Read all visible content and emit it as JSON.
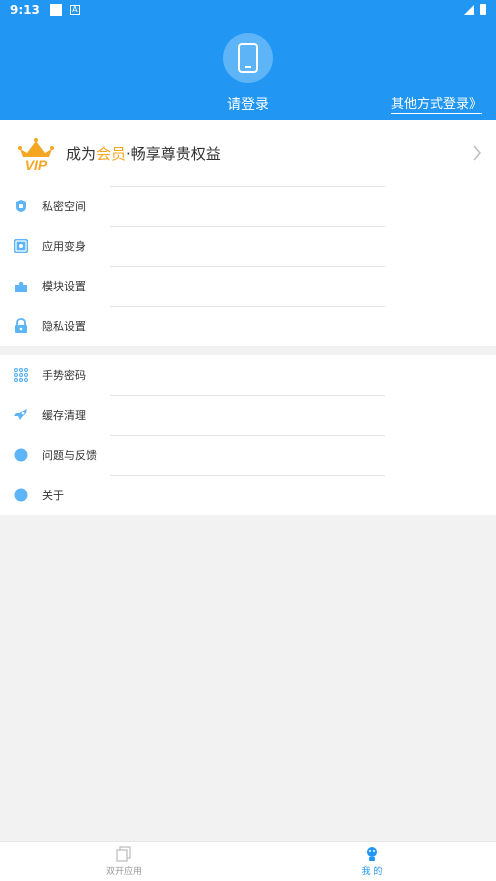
{
  "status_bar": {
    "time": "9:13",
    "notif_a": "A"
  },
  "header": {
    "login_label": "请登录",
    "other_login_label": "其他方式登录》"
  },
  "vip": {
    "text_prefix": "成为",
    "text_highlight": "会员",
    "text_suffix": "·畅享尊贵权益",
    "badge_text": "VIP"
  },
  "menu_group_1": [
    {
      "label": "私密空间",
      "icon": "private-space-icon"
    },
    {
      "label": "应用变身",
      "icon": "app-disguise-icon"
    },
    {
      "label": "模块设置",
      "icon": "module-settings-icon"
    },
    {
      "label": "隐私设置",
      "icon": "privacy-lock-icon"
    }
  ],
  "menu_group_2": [
    {
      "label": "手势密码",
      "icon": "gesture-pattern-icon"
    },
    {
      "label": "缓存清理",
      "icon": "cache-clean-icon"
    },
    {
      "label": "问题与反馈",
      "icon": "feedback-icon"
    },
    {
      "label": "关于",
      "icon": "about-icon"
    }
  ],
  "bottom_nav": [
    {
      "label": "双开应用",
      "icon": "dual-apps-icon",
      "active": false
    },
    {
      "label": "我 的",
      "icon": "profile-icon",
      "active": true
    }
  ],
  "colors": {
    "primary": "#2196f3",
    "vip_gold": "#f5a623",
    "icon_blue": "#5db4f7",
    "inactive_nav": "#999999"
  }
}
